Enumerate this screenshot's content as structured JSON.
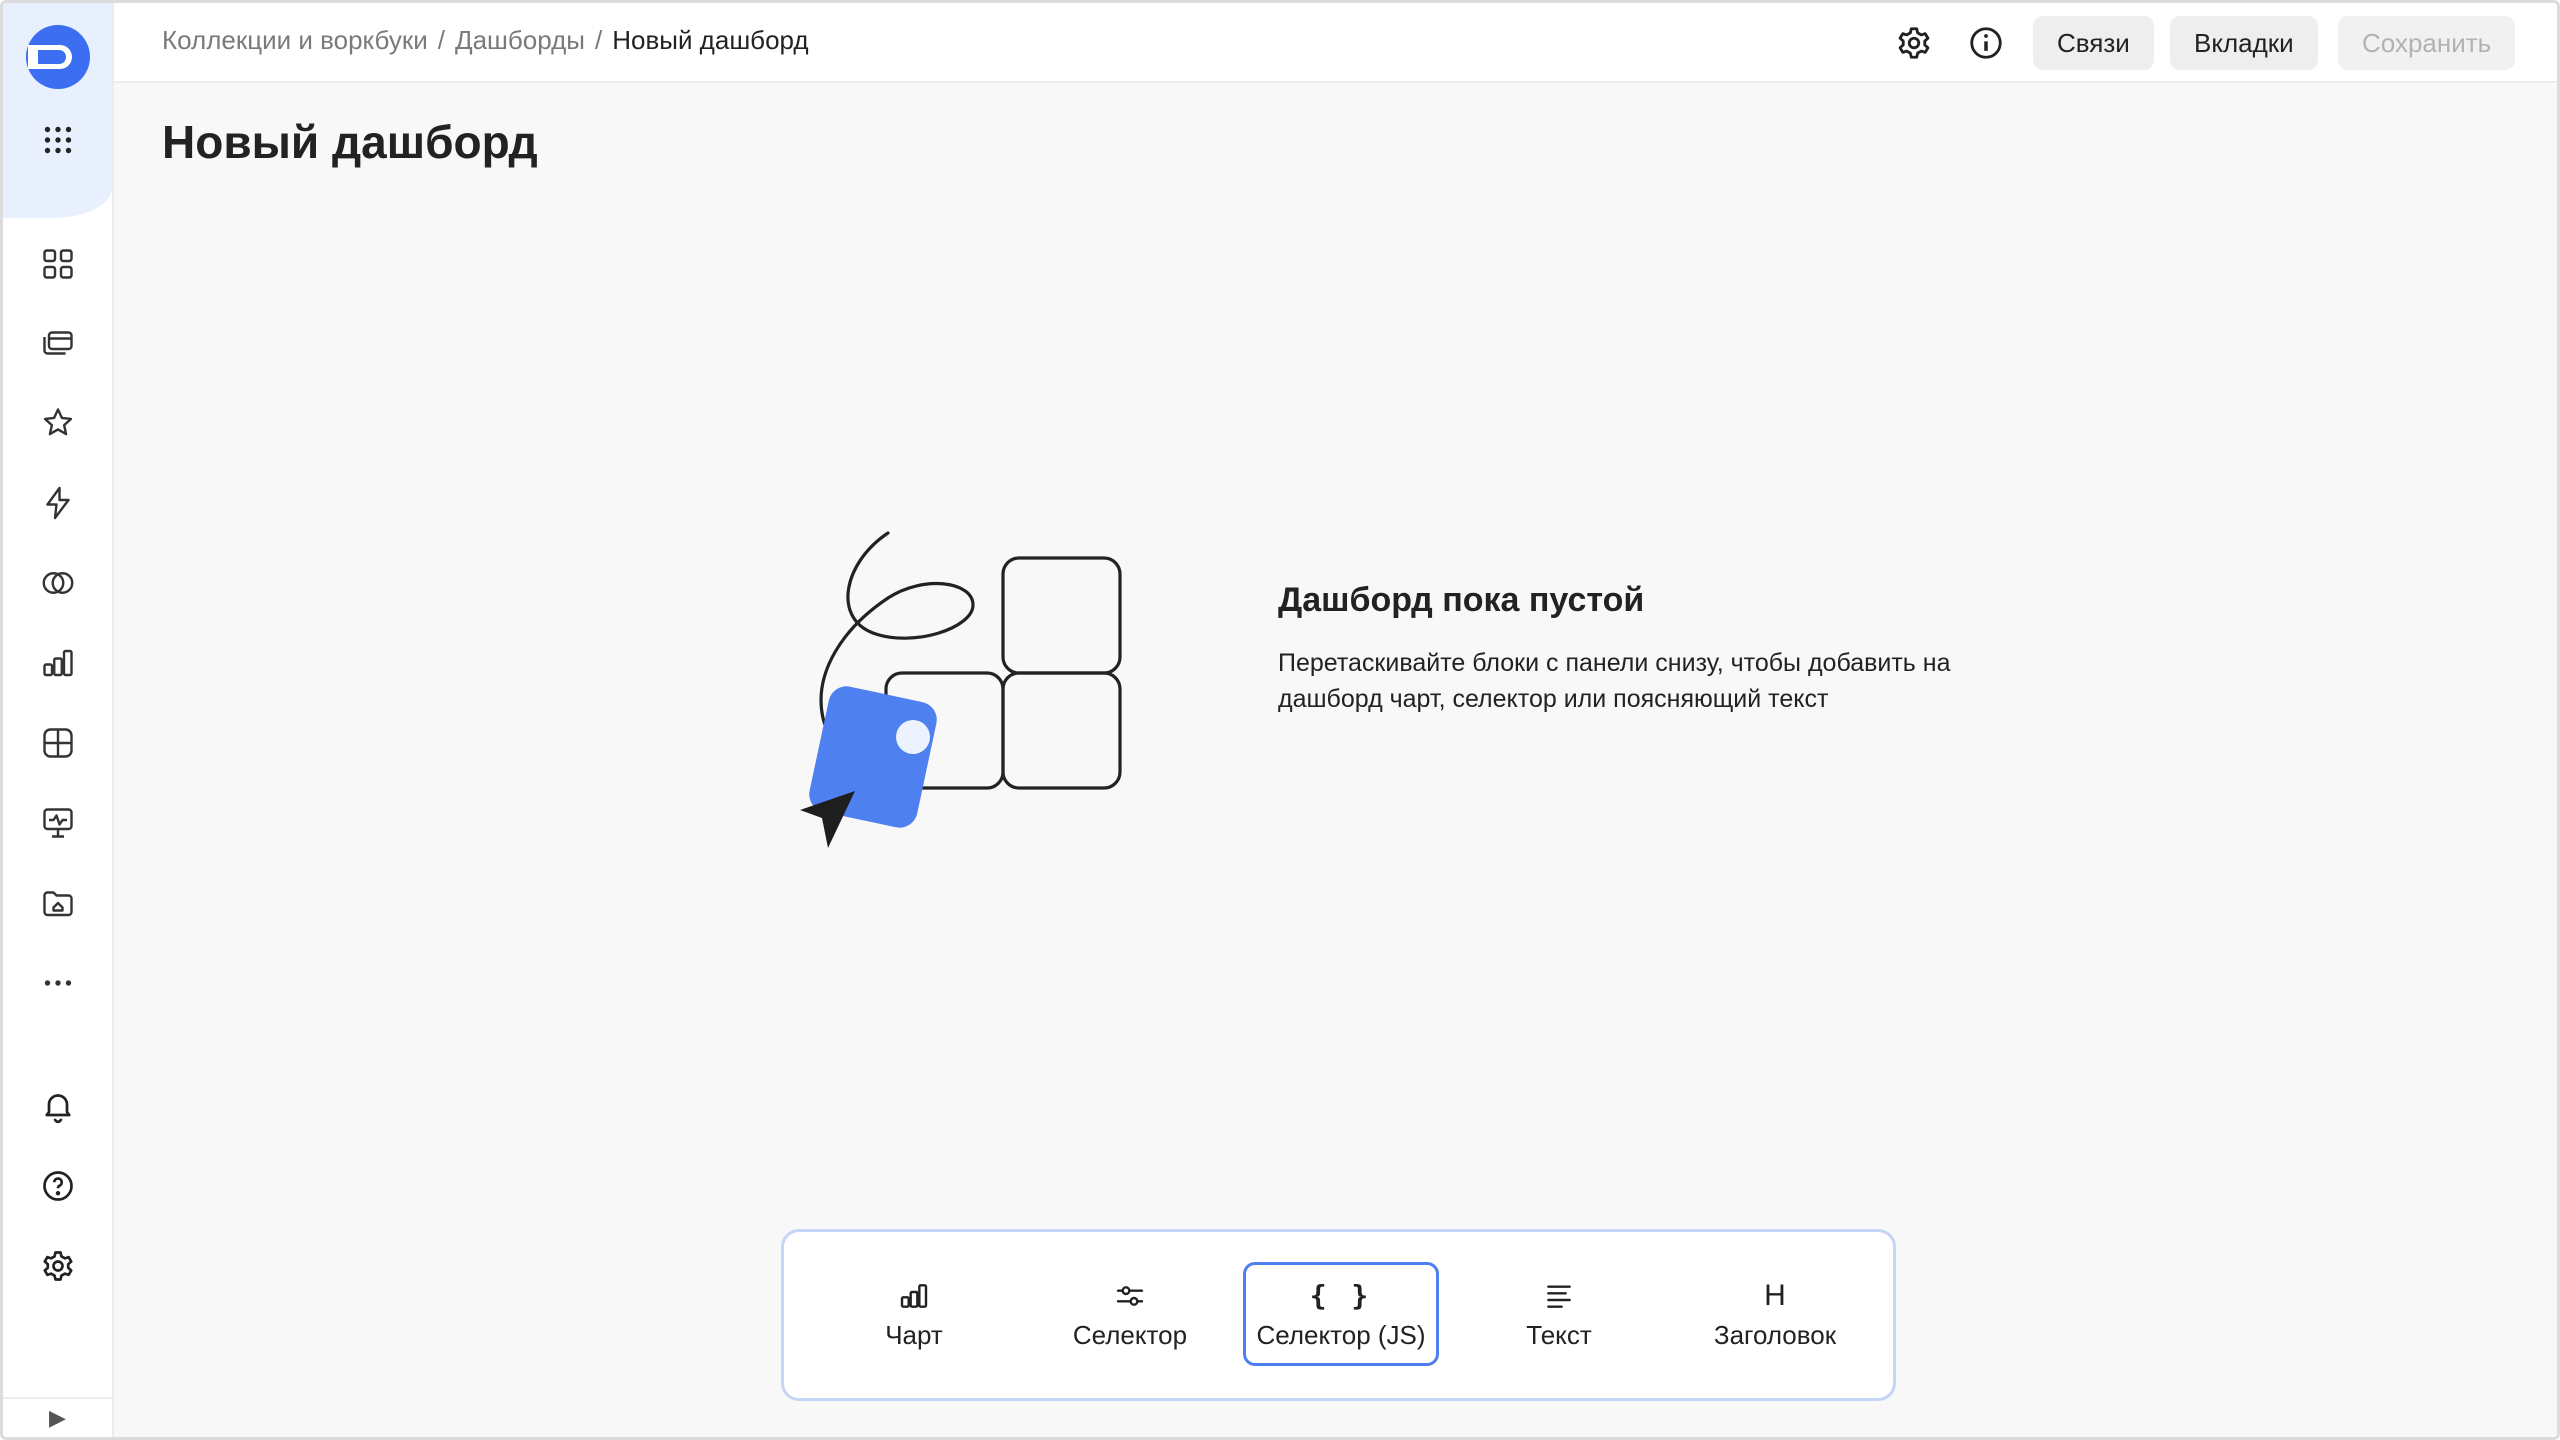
{
  "breadcrumb": {
    "items": [
      "Коллекции и воркбуки",
      "Дашборды"
    ],
    "separator": "/",
    "current": "Новый дашборд"
  },
  "header": {
    "buttons": {
      "links": "Связи",
      "tabs": "Вкладки",
      "save": "Сохранить"
    },
    "icons": [
      "gear-icon",
      "info-icon"
    ]
  },
  "page": {
    "title": "Новый дашборд"
  },
  "empty_state": {
    "title": "Дашборд пока пустой",
    "description": "Перетаскивайте блоки с панели снизу, чтобы добавить на дашборд чарт, селектор или поясняющий текст"
  },
  "palette": {
    "items": [
      {
        "label": "Чарт",
        "icon": "chart-icon"
      },
      {
        "label": "Селектор",
        "icon": "sliders-icon"
      },
      {
        "label": "Селектор (JS)",
        "icon": "braces-icon",
        "glyph": "{ }",
        "active": true
      },
      {
        "label": "Текст",
        "icon": "text-lines-icon"
      },
      {
        "label": "Заголовок",
        "icon": "heading-icon",
        "glyph": "H"
      }
    ]
  },
  "sidebar": {
    "icons": [
      "apps-grid-icon",
      "dashboards-icon",
      "collections-icon",
      "favorites-icon",
      "connections-icon",
      "datasets-icon",
      "charts-icon",
      "widgets-icon",
      "monitoring-icon",
      "workbooks-icon",
      "more-icon",
      "notifications-icon",
      "help-icon",
      "settings-icon",
      "collapse-icon"
    ]
  },
  "colors": {
    "accent": "#4d7ef2",
    "accent_light": "#e8effd",
    "background": "#f8f8f8"
  }
}
